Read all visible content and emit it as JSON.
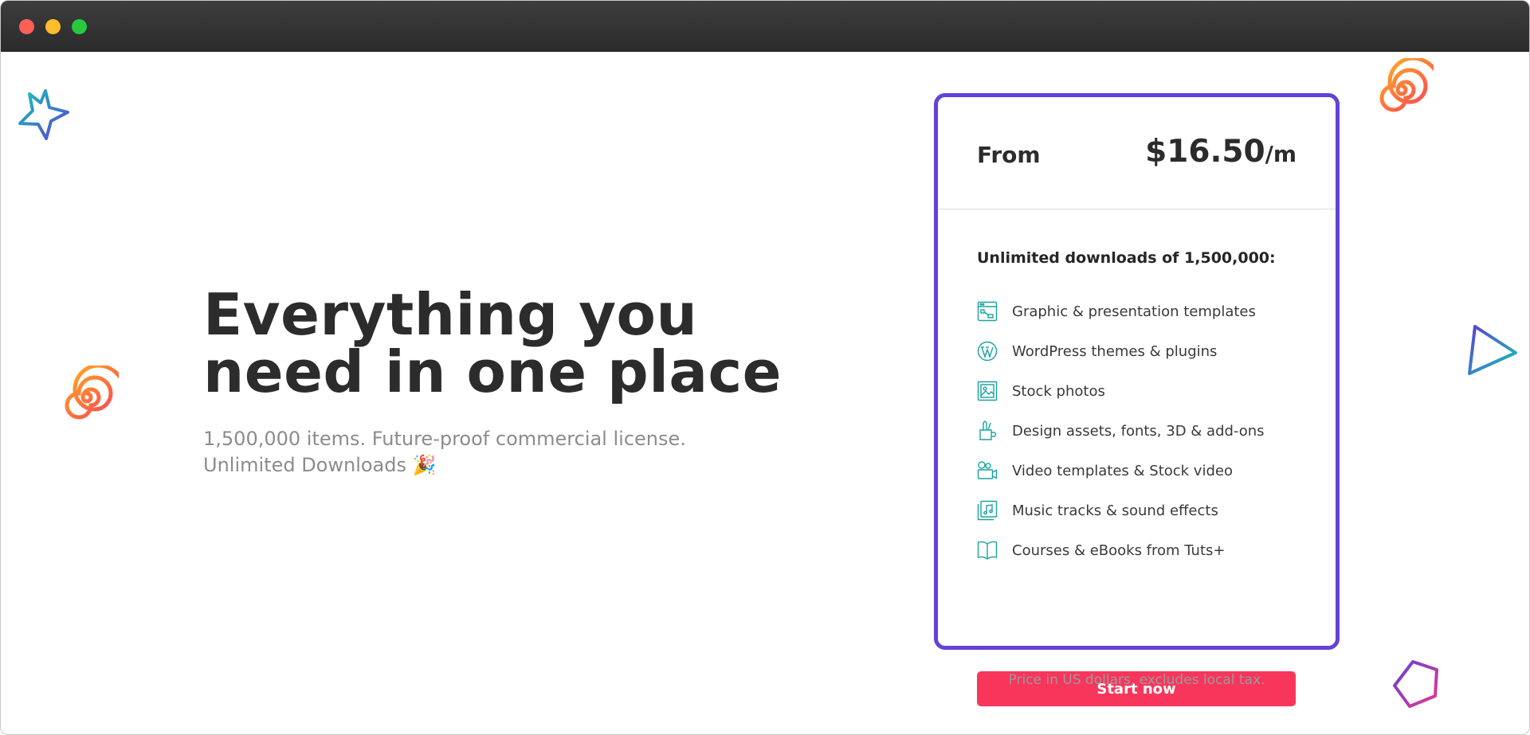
{
  "window": {
    "controls": [
      "close",
      "minimize",
      "maximize"
    ]
  },
  "hero": {
    "title_line1": "Everything you",
    "title_line2": "need in one place",
    "subtitle_line1": "1,500,000 items. Future-proof commercial license.",
    "subtitle_line2": "Unlimited Downloads 🎉"
  },
  "pricing": {
    "from_label": "From",
    "price": "$16.50",
    "period": "/m",
    "headline": "Unlimited downloads of 1,500,000:",
    "features": [
      {
        "label": "Graphic & presentation templates",
        "icon": "graphic-template-icon"
      },
      {
        "label": "WordPress themes & plugins",
        "icon": "wordpress-icon"
      },
      {
        "label": "Stock photos",
        "icon": "photo-icon"
      },
      {
        "label": "Design assets, fonts, 3D & add-ons",
        "icon": "design-assets-icon"
      },
      {
        "label": "Video templates & Stock video",
        "icon": "video-camera-icon"
      },
      {
        "label": "Music tracks & sound effects",
        "icon": "music-icon"
      },
      {
        "label": "Courses & eBooks from Tuts+",
        "icon": "book-icon"
      }
    ],
    "cta_label": "Start now",
    "note": "Price in US dollars, excludes local tax."
  },
  "colors": {
    "accent_border": "#6342d8",
    "cta": "#f8365c",
    "icon_teal": "#1ba39c"
  }
}
